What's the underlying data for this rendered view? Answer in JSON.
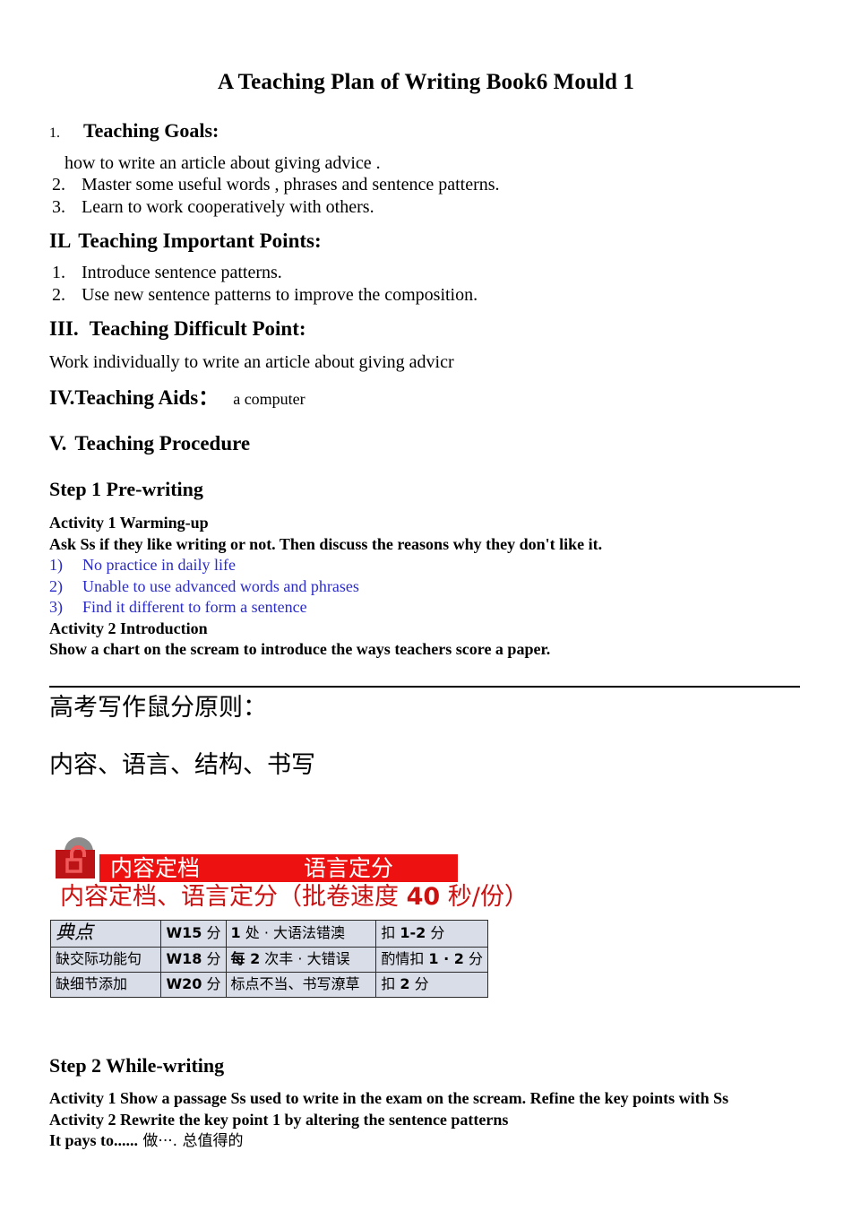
{
  "document": {
    "title": "A Teaching Plan of Writing Book6 Mould 1",
    "sections": {
      "goals": {
        "number": "1.",
        "heading": "Teaching Goals:",
        "items": [
          {
            "num": "",
            "text": "how to write an article about giving advice ."
          },
          {
            "num": "2.",
            "text": "Master some useful words , phrases and sentence patterns."
          },
          {
            "num": "3.",
            "text": "Learn to work cooperatively with others."
          }
        ]
      },
      "important_points": {
        "heading_numeral": "IL",
        "heading": "Teaching Important Points:",
        "items": [
          {
            "num": "1.",
            "text": "Introduce sentence patterns."
          },
          {
            "num": "2.",
            "text": "Use new sentence patterns to improve the composition."
          }
        ]
      },
      "difficult_point": {
        "heading_numeral": "III.",
        "heading": "Teaching Difficult Point:",
        "body": "Work individually to write an article about giving advicr"
      },
      "teaching_aids": {
        "heading_numeral": "IV.",
        "heading": "Teaching Aids：",
        "value": "a computer"
      },
      "procedure": {
        "heading_numeral": "V.",
        "heading": "Teaching Procedure"
      },
      "step1": {
        "heading": "Step 1 Pre-writing",
        "activity1_title": "Activity 1 Warming-up",
        "activity1_prompt": "Ask Ss if they like writing or not. Then discuss the reasons why they don't like it.",
        "reasons": [
          {
            "num": "1)",
            "text": "No practice in daily life"
          },
          {
            "num": "2)",
            "text": "Unable to use advanced words and phrases"
          },
          {
            "num": "3)",
            "text": "Find it different to form a sentence"
          }
        ],
        "activity2_title": "Activity 2 Introduction",
        "activity2_prompt": "Show a chart on the scream to introduce the ways teachers score a paper."
      },
      "step2": {
        "heading": "Step 2 While-writing",
        "lines": [
          "Activity 1 Show a passage Ss used to write in the exam on the scream. Refine the key points with Ss",
          "Activity 2 Rewrite the key point 1 by altering the sentence patterns"
        ],
        "phrase_en": "It pays to......",
        "phrase_cn": " 做···. 总值得的"
      }
    }
  },
  "slide": {
    "chinese_heading_1": "高考写作鼠分原则：",
    "chinese_heading_2": "内容、语言、结构、书写",
    "banner": {
      "left_label": "内容定档",
      "right_label": "语言定分",
      "background_color": "#ee1111",
      "text_color": "#ffffff"
    },
    "headline": {
      "prefix": "内容定档、语言定分（批卷速度 ",
      "emphasis": "40",
      "suffix": " 秒/份）",
      "color": "#cc1111"
    },
    "lock_icon": {
      "name": "open-padlock-icon",
      "body_color": "#cc1111",
      "shackle_color": "#8c8c8c"
    },
    "table": {
      "background_color": "#d9dde8",
      "rows": [
        {
          "c1": "典点",
          "c1_style": "cursive",
          "c2_bold": "W15",
          "c2_rest": " 分",
          "c3_bold": "1",
          "c3_rest": " 处 · 大语法错澳",
          "c4_pre": "扣 ",
          "c4_bold": "1-2",
          "c4_post": " 分"
        },
        {
          "c1": "缺交际功能句",
          "c1_style": "normal",
          "c2_bold": "W18",
          "c2_rest": " 分",
          "c3_bold": "每 2",
          "c3_rest": " 次丰 · 大错误",
          "c4_pre": "酌情扣 ",
          "c4_bold": "1 · 2",
          "c4_post": " 分"
        },
        {
          "c1": "缺细节添加",
          "c1_style": "normal",
          "c2_bold": "W20",
          "c2_rest": " 分",
          "c3_bold": "",
          "c3_rest": "标点不当、书写潦草",
          "c4_pre": "扣 ",
          "c4_bold": "2",
          "c4_post": " 分"
        }
      ]
    }
  }
}
